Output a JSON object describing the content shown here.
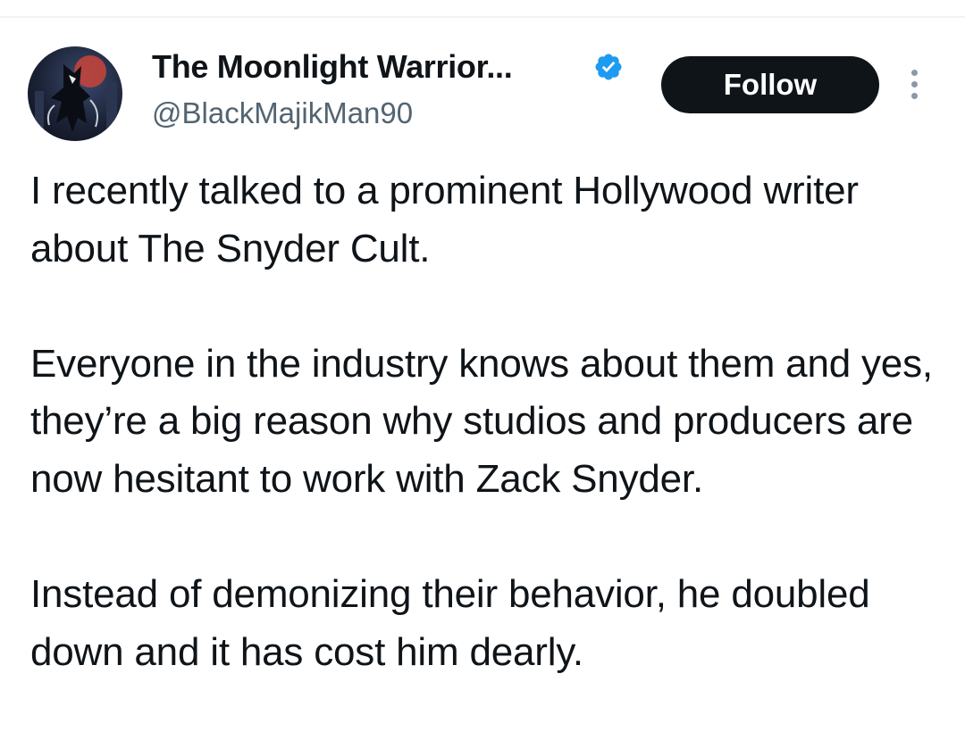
{
  "author": {
    "display_name": "The Moonlight Warrior...",
    "handle": "@BlackMajikMan90",
    "verified": true,
    "verified_color": "#1d9bf0"
  },
  "actions": {
    "follow_label": "Follow"
  },
  "icons": {
    "verified": "verified-badge-icon",
    "more": "more-vertical-icon"
  },
  "tweet": {
    "paragraphs": [
      "I recently talked to a prominent Hollywood writer about The Snyder Cult.",
      "Everyone in the industry knows about them and yes, they’re a big reason why studios and producers are now hesitant to work with Zack Snyder.",
      "Instead of demonizing their behavior, he doubled down and it has cost him dearly."
    ]
  }
}
